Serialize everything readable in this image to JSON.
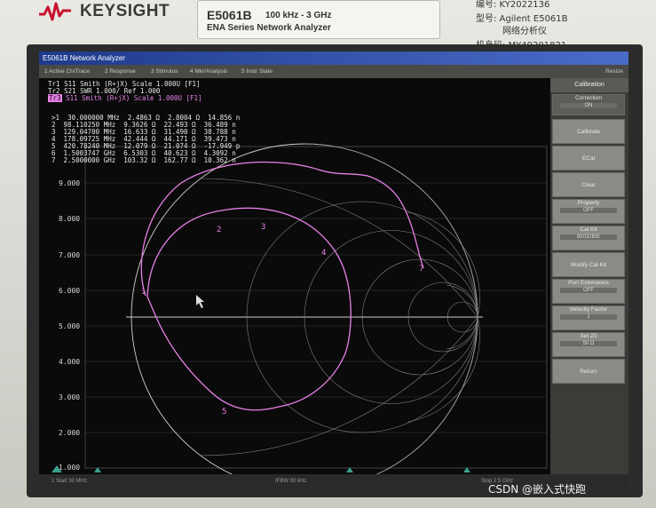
{
  "instrument": {
    "brand": "KEYSIGHT",
    "model": "E5061B",
    "freq_range": "100 kHz - 3 GHz",
    "series": "ENA Series Network Analyzer"
  },
  "asset_label": {
    "serial_line": "编号: KY2022136",
    "type_label": "型号: Agilent E5061B",
    "type_desc": "网络分析仪",
    "machine_id": "机身码: MY49201821"
  },
  "window": {
    "title": "E5061B Network Analyzer",
    "resize": "Resize"
  },
  "menu": [
    "1 Active Ch/Trace",
    "2 Response",
    "3 Stimulus",
    "4 Mkr/Analysis",
    "5 Instr State"
  ],
  "traces": [
    {
      "label": "Tr1",
      "text": "S11  Smith (R+jX) Scale 1.000U [F1]"
    },
    {
      "label": "Tr2",
      "text": "S21  SWR 1.000/ Ref 1.000"
    },
    {
      "label": "Tr3",
      "text": "S11  Smith (R+jX) Scale 1.000U [F1]"
    }
  ],
  "markers": [
    {
      "n": ">1",
      "freq": "30.000000 MHz",
      "r": "2.4863 Ω",
      "x": "2.8004 Ω",
      "l": "14.856 n"
    },
    {
      "n": "2",
      "freq": "98.110250 MHz",
      "r": "9.3626 Ω",
      "x": "22.493 Ω",
      "l": "36.489 n"
    },
    {
      "n": "3",
      "freq": "129.04700 MHz",
      "r": "16.633 Ω",
      "x": "31.490 Ω",
      "l": "38.788 n"
    },
    {
      "n": "4",
      "freq": "178.09725 MHz",
      "r": "42.444 Ω",
      "x": "44.171 Ω",
      "l": "39.473 n"
    },
    {
      "n": "5",
      "freq": "420.78240 MHz",
      "r": "12.079 Ω",
      "x": "21.074 Ω",
      "l": "-17.949 p"
    },
    {
      "n": "6",
      "freq": "1.5003747 GHz",
      "r": "6.5303 Ω",
      "x": "40.623 Ω",
      "l": "4.3092 n"
    },
    {
      "n": "7",
      "freq": "2.5000000 GHz",
      "r": "103.32 Ω",
      "x": "162.77 Ω",
      "l": "10.362 n"
    }
  ],
  "y_ticks": [
    "9.000",
    "8.000",
    "7.000",
    "6.000",
    "5.000",
    "4.000",
    "3.000",
    "2.000",
    "1.000"
  ],
  "bottom": {
    "start": "1 Start 30 MHz",
    "ifbw": "IFBW 30 kHz",
    "stop": "Stop 2.5 GHz"
  },
  "softkeys": {
    "title": "Calibration",
    "items": [
      {
        "label": "Correction",
        "value": "ON"
      },
      {
        "label": "Calibrate",
        "value": ""
      },
      {
        "label": "ECal",
        "value": ""
      },
      {
        "label": "Clear",
        "value": ""
      },
      {
        "label": "Property",
        "value": "OFF"
      },
      {
        "label": "Cal Kit",
        "value": "85032B/E"
      },
      {
        "label": "Modify Cal Kit",
        "value": ""
      },
      {
        "label": "Port Extensions",
        "value": "OFF"
      },
      {
        "label": "Velocity Factor",
        "value": "1"
      },
      {
        "label": "Set Z0",
        "value": "50 Ω"
      },
      {
        "label": "Return",
        "value": ""
      }
    ]
  },
  "watermark": "CSDN @嵌入式快跑",
  "colors": {
    "smith_trace": "#e880e8",
    "grid": "#c8c8c8",
    "title_bar": "#1e3a8c"
  }
}
